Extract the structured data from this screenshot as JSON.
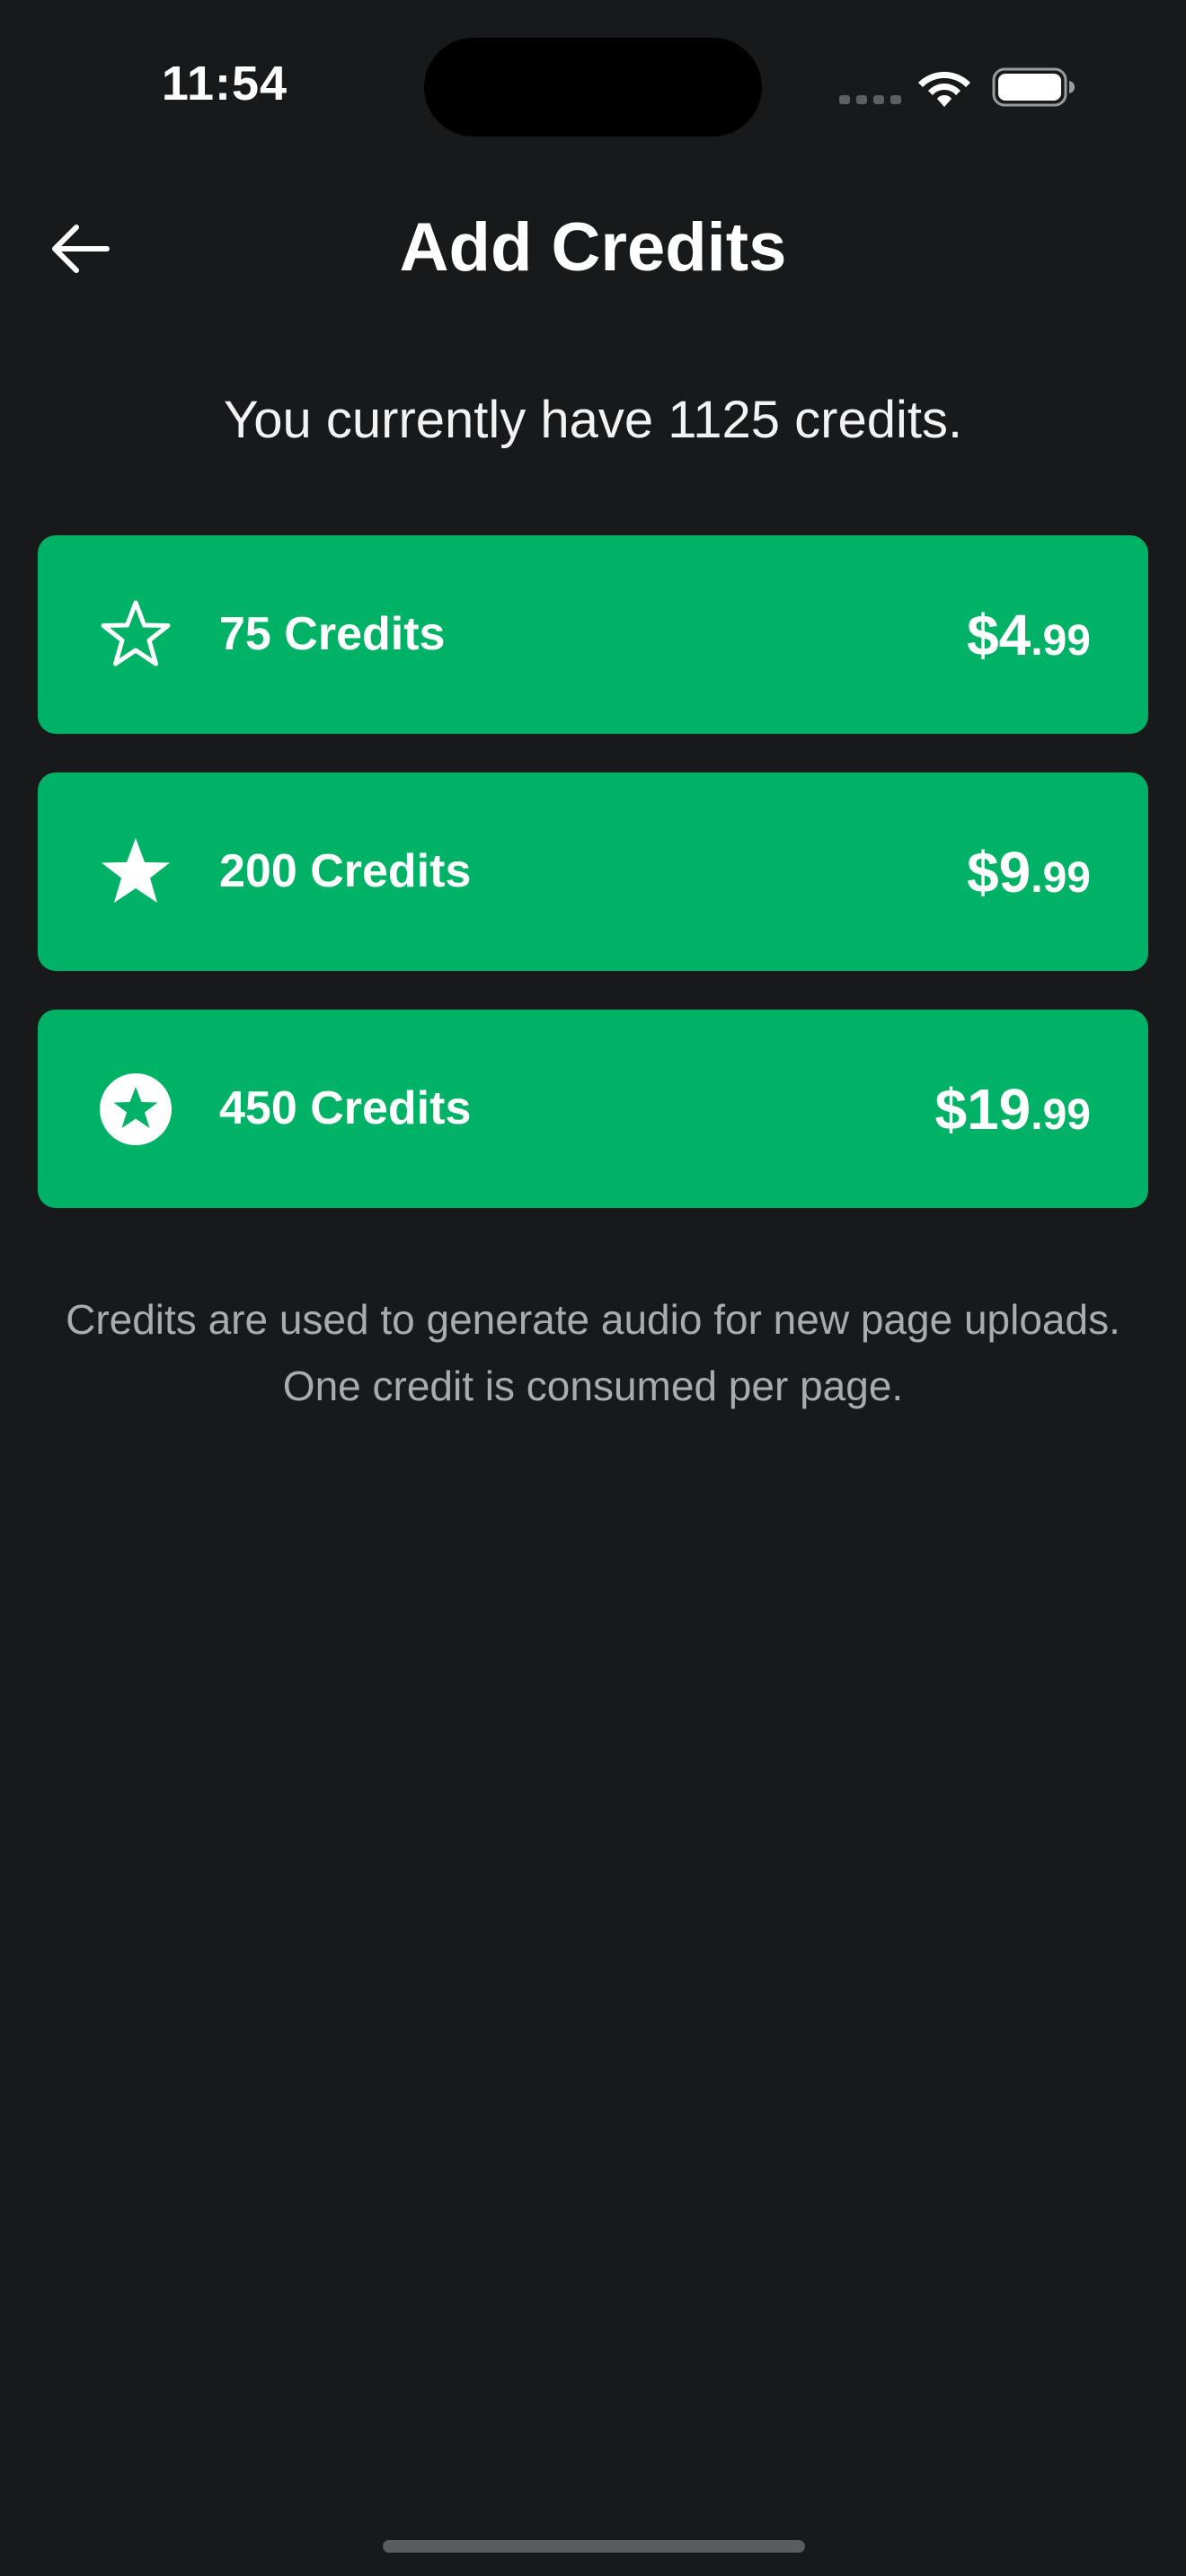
{
  "status_bar": {
    "time": "11:54"
  },
  "header": {
    "title": "Add Credits",
    "back_icon": "arrow-left-icon"
  },
  "balance": {
    "text": "You currently have 1125 credits."
  },
  "packages": [
    {
      "label": "75 Credits",
      "price_main": "$4",
      "price_cents": ".99",
      "icon": "star-outline-icon"
    },
    {
      "label": "200 Credits",
      "price_main": "$9",
      "price_cents": ".99",
      "icon": "star-filled-icon"
    },
    {
      "label": "450 Credits",
      "price_main": "$19",
      "price_cents": ".99",
      "icon": "star-circle-icon"
    }
  ],
  "info": {
    "line1": "Credits are used to generate audio for new page uploads.",
    "line2": "One credit is consumed per page."
  },
  "colors": {
    "background": "#18191b",
    "accent": "#00b265",
    "secondary_text": "#a9abae"
  }
}
